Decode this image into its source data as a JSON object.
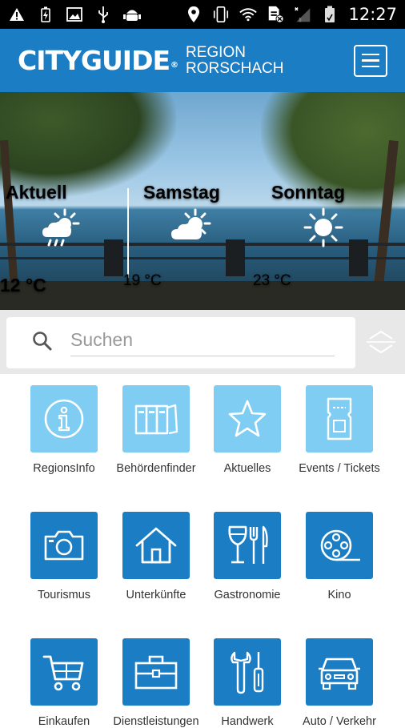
{
  "status_bar": {
    "time": "12:27",
    "icons": [
      "warning-icon",
      "battery-charging-icon",
      "image-icon",
      "usb-icon",
      "android-debug-icon",
      "location-icon",
      "phone-vibrate-icon",
      "wifi-icon",
      "sim-off-icon",
      "signal-icon",
      "battery-icon"
    ]
  },
  "header": {
    "logo_text": "CITYGUIDE",
    "logo_reg": "®",
    "region_line1": "REGION",
    "region_line2": "RORSCHACH",
    "bg_color": "#1b7dc4"
  },
  "weather": [
    {
      "title": "Aktuell",
      "temp": "12 °C",
      "icon": "cloud-sun-rain-icon"
    },
    {
      "title": "Samstag",
      "temp": "19 °C",
      "icon": "cloud-sun-icon"
    },
    {
      "title": "Sonntag",
      "temp": "23 °C",
      "icon": "sun-icon"
    }
  ],
  "search": {
    "placeholder": "Suchen"
  },
  "tiles": [
    {
      "label": "RegionsInfo",
      "icon": "info-icon",
      "style": "light"
    },
    {
      "label": "Behördenfinder",
      "icon": "folders-icon",
      "style": "light"
    },
    {
      "label": "Aktuelles",
      "icon": "star-icon",
      "style": "light"
    },
    {
      "label": "Events / Tickets",
      "icon": "ticket-icon",
      "style": "light"
    },
    {
      "label": "Tourismus",
      "icon": "camera-icon",
      "style": "dark"
    },
    {
      "label": "Unterkünfte",
      "icon": "house-icon",
      "style": "dark"
    },
    {
      "label": "Gastronomie",
      "icon": "wine-cutlery-icon",
      "style": "dark"
    },
    {
      "label": "Kino",
      "icon": "film-reel-icon",
      "style": "dark"
    },
    {
      "label": "Einkaufen",
      "icon": "shopping-cart-icon",
      "style": "dark"
    },
    {
      "label": "Dienstleistungen",
      "icon": "briefcase-icon",
      "style": "dark"
    },
    {
      "label": "Handwerk",
      "icon": "tools-icon",
      "style": "dark"
    },
    {
      "label": "Auto / Verkehr",
      "icon": "car-icon",
      "style": "dark"
    }
  ],
  "colors": {
    "tile_light": "#7fcdf3",
    "tile_dark": "#1b7dc4"
  }
}
